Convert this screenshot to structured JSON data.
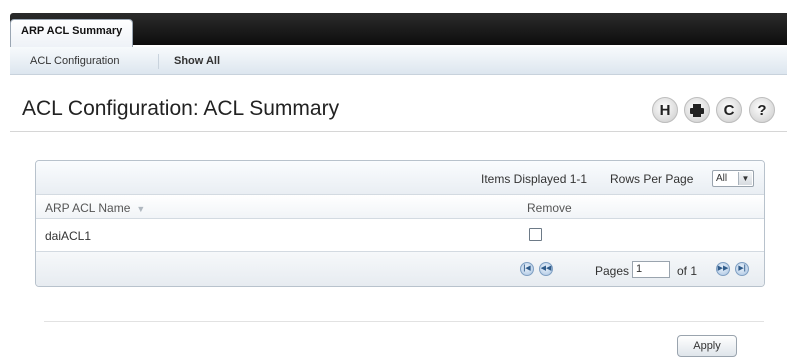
{
  "tabs": {
    "active_label": "ARP ACL Summary"
  },
  "subnav": {
    "items": [
      "ACL Configuration",
      "Show All"
    ]
  },
  "header": {
    "title": "ACL Configuration: ACL Summary"
  },
  "toolbar": {
    "icons": [
      "save-icon",
      "print-icon",
      "refresh-icon",
      "help-icon"
    ],
    "save_glyph": "H",
    "refresh_glyph": "C",
    "help_glyph": "?"
  },
  "table": {
    "items_displayed_label": "Items Displayed 1-1",
    "rows_per_page_label": "Rows Per Page",
    "rows_per_page_value": "All",
    "columns": [
      "ARP ACL Name",
      "Remove"
    ],
    "rows": [
      {
        "name": "daiACL1",
        "remove": false
      }
    ],
    "pagination": {
      "pages_label": "Pages",
      "current_page": "1",
      "of_label": "of 1"
    }
  },
  "actions": {
    "apply_label": "Apply"
  }
}
